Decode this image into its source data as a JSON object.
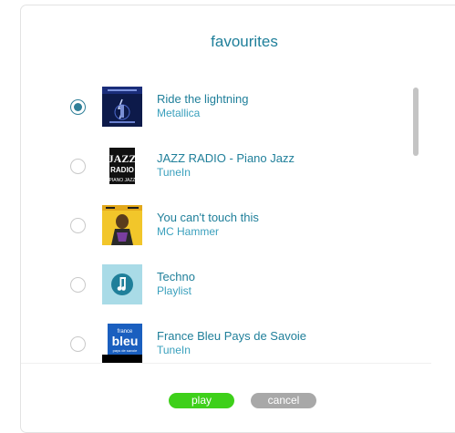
{
  "dialog": {
    "title": "favourites"
  },
  "items": [
    {
      "name": "Ride the lightning",
      "source": "Metallica",
      "selected": true,
      "thumb_icon": "album-art-ride-the-lightning"
    },
    {
      "name": "JAZZ RADIO - Piano Jazz",
      "source": "TuneIn",
      "selected": false,
      "thumb_icon": "jazz-radio-logo",
      "thumb_text": [
        "JAZZ",
        "RADIO",
        "PIANO JAZZ"
      ]
    },
    {
      "name": "You can't touch this",
      "source": "MC Hammer",
      "selected": false,
      "thumb_icon": "album-art-mc-hammer"
    },
    {
      "name": "Techno",
      "source": "Playlist",
      "selected": false,
      "thumb_icon": "music-note-icon"
    },
    {
      "name": "France Bleu Pays de Savoie",
      "source": "TuneIn",
      "selected": false,
      "thumb_icon": "france-bleu-logo",
      "thumb_text": [
        "france",
        "bleu",
        "pays de savoie"
      ]
    }
  ],
  "buttons": {
    "play": "play",
    "cancel": "cancel"
  },
  "colors": {
    "accent": "#1f7f9a",
    "play_button": "#3ed01a",
    "cancel_button": "#a8a8a8"
  }
}
